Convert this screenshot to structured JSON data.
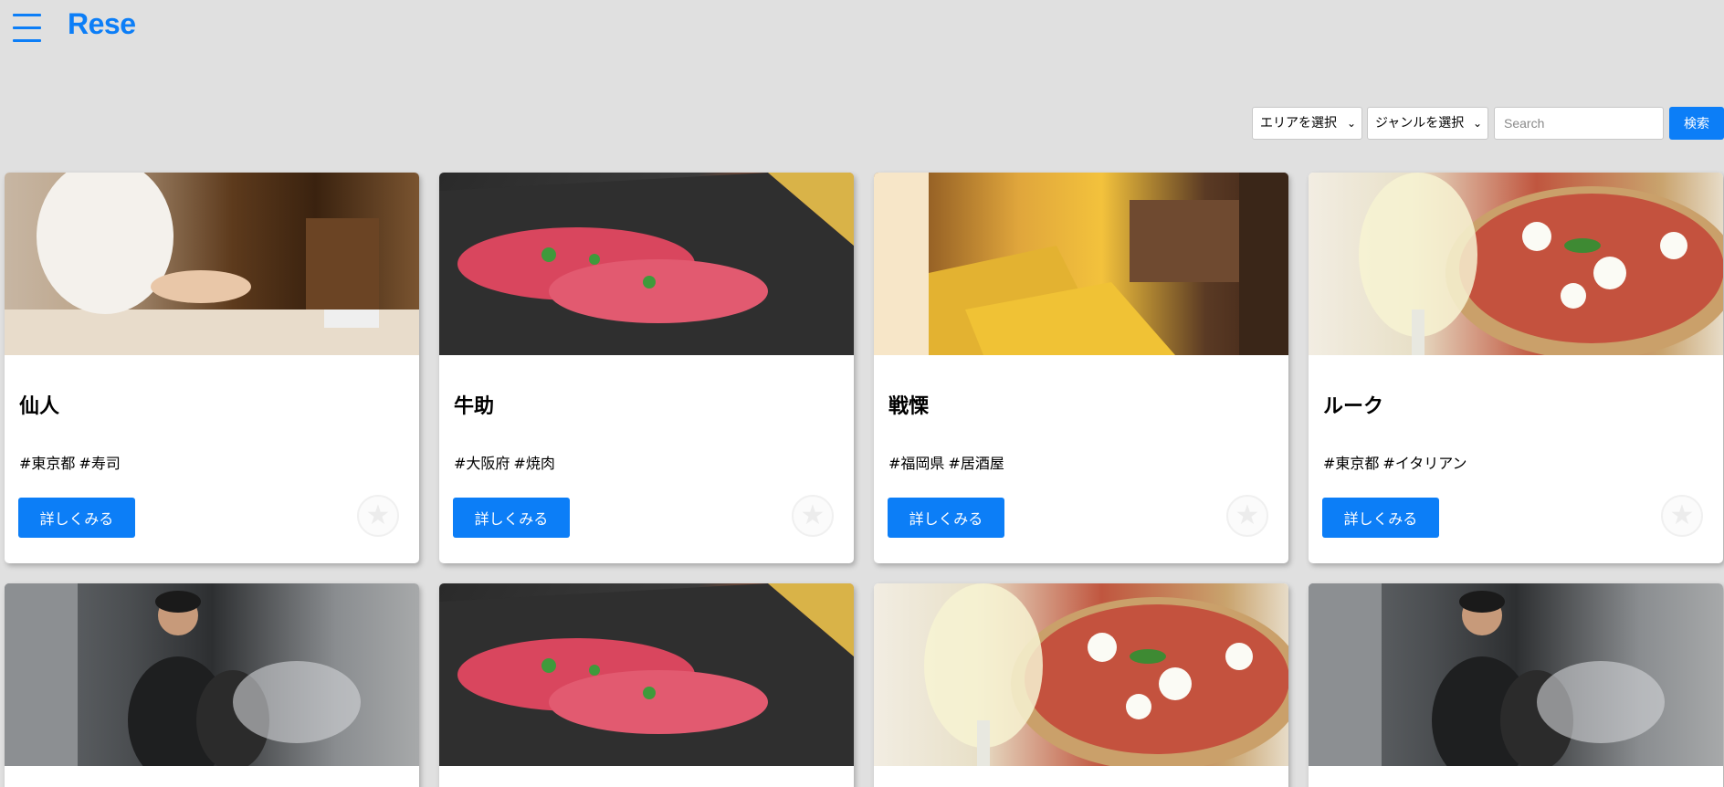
{
  "header": {
    "logo": "Rese",
    "menu_icon": "hamburger-menu-icon"
  },
  "search": {
    "area_selected": "エリアを選択",
    "genre_selected": "ジャンルを選択",
    "placeholder": "Search",
    "button_label": "検索"
  },
  "card_button_label": "詳しくみる",
  "shops": [
    {
      "name": "仙人",
      "area": "#東京都",
      "genre": "#寿司",
      "image": "sushi-chef"
    },
    {
      "name": "牛助",
      "area": "#大阪府",
      "genre": "#焼肉",
      "image": "wagyu-beef"
    },
    {
      "name": "戦慄",
      "area": "#福岡県",
      "genre": "#居酒屋",
      "image": "izakaya-interior"
    },
    {
      "name": "ルーク",
      "area": "#東京都",
      "genre": "#イタリアン",
      "image": "pizza-wine"
    },
    {
      "image": "kitchen-chef"
    },
    {
      "image": "wagyu-beef"
    },
    {
      "image": "pizza-wine"
    },
    {
      "image": "kitchen-chef"
    }
  ],
  "colors": {
    "accent": "#0c7ef7",
    "background": "#e0e0e0"
  }
}
